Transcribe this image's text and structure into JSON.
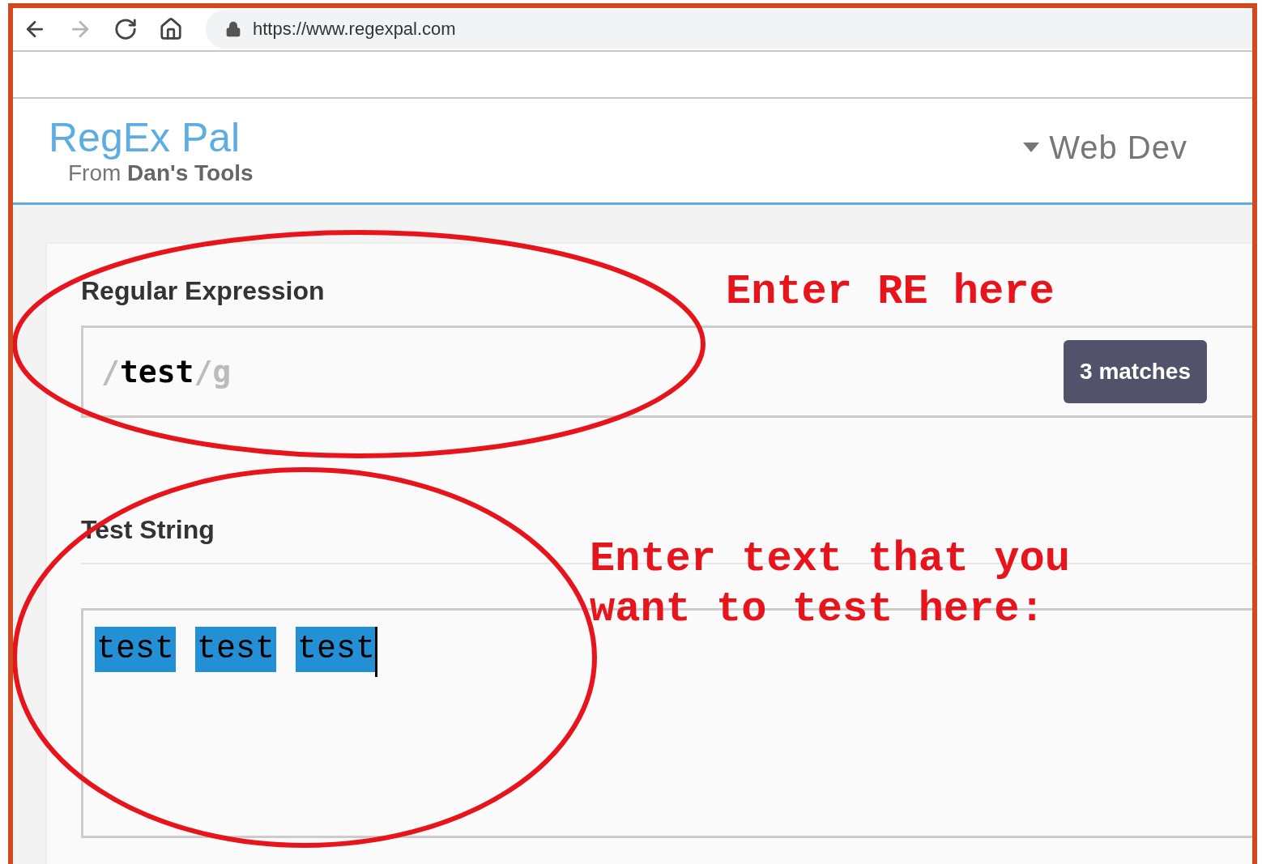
{
  "browser": {
    "nav_buttons": [
      {
        "kind": "back",
        "disabled": false
      },
      {
        "kind": "forward",
        "disabled": true
      },
      {
        "kind": "reload",
        "disabled": false
      },
      {
        "kind": "home",
        "disabled": false
      }
    ],
    "url": "https://www.regexpal.com"
  },
  "site": {
    "title": "RegEx Pal",
    "subtitle": "From **Dan's Tools**",
    "nav": [
      {
        "label": "Web Dev"
      }
    ]
  },
  "regex": {
    "label": "Regular Expression",
    "open_delimiter": "/",
    "pattern": "test",
    "close_delimiter": "/",
    "flags": "g",
    "match_badge": "3 matches"
  },
  "test_string": {
    "label": "Test String",
    "tokens": [
      {
        "text": "test",
        "highlighted": true
      },
      {
        "text": "test",
        "highlighted": true
      },
      {
        "text": "test",
        "highlighted": true
      }
    ],
    "cursor": true
  },
  "annotations": [
    {
      "kind": "ring"
    },
    {
      "kind": "ring"
    },
    {
      "kind": "note",
      "lines": [
        "Enter RE here"
      ]
    },
    {
      "kind": "note",
      "lines": [
        "Enter text that you",
        "want to test here:"
      ]
    }
  ]
}
